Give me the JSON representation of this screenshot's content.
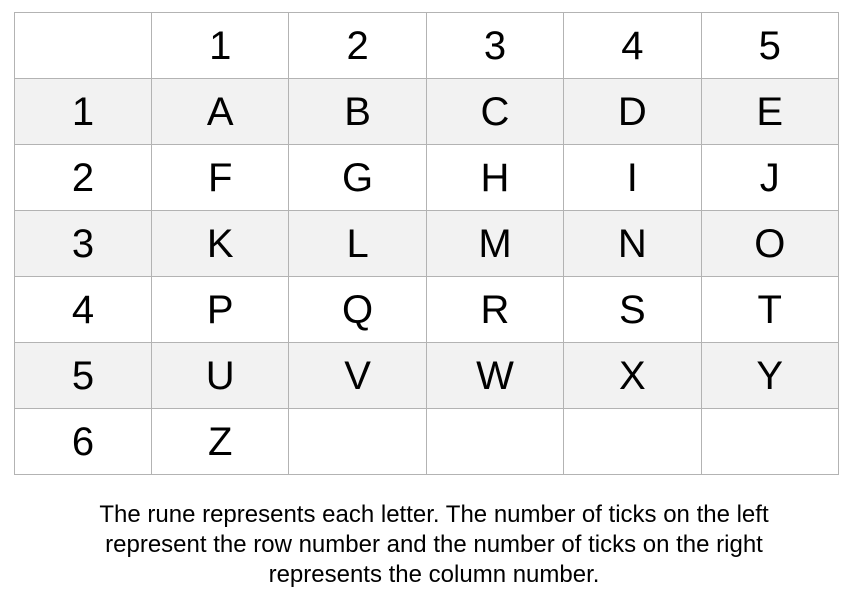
{
  "table": {
    "header": [
      "",
      "1",
      "2",
      "3",
      "4",
      "5"
    ],
    "rows": [
      [
        "1",
        "A",
        "B",
        "C",
        "D",
        "E"
      ],
      [
        "2",
        "F",
        "G",
        "H",
        "I",
        "J"
      ],
      [
        "3",
        "K",
        "L",
        "M",
        "N",
        "O"
      ],
      [
        "4",
        "P",
        "Q",
        "R",
        "S",
        "T"
      ],
      [
        "5",
        "U",
        "V",
        "W",
        "X",
        "Y"
      ],
      [
        "6",
        "Z",
        "",
        "",
        "",
        ""
      ]
    ]
  },
  "caption": {
    "line1": "The rune represents each letter. The number of ticks on the left",
    "line2": "represent the row number and the number of ticks on the right",
    "line3": "represents the column number."
  },
  "colors": {
    "grid_line": "#b3b3b3",
    "shaded_row": "#f2f2f2",
    "text": "#000000"
  }
}
